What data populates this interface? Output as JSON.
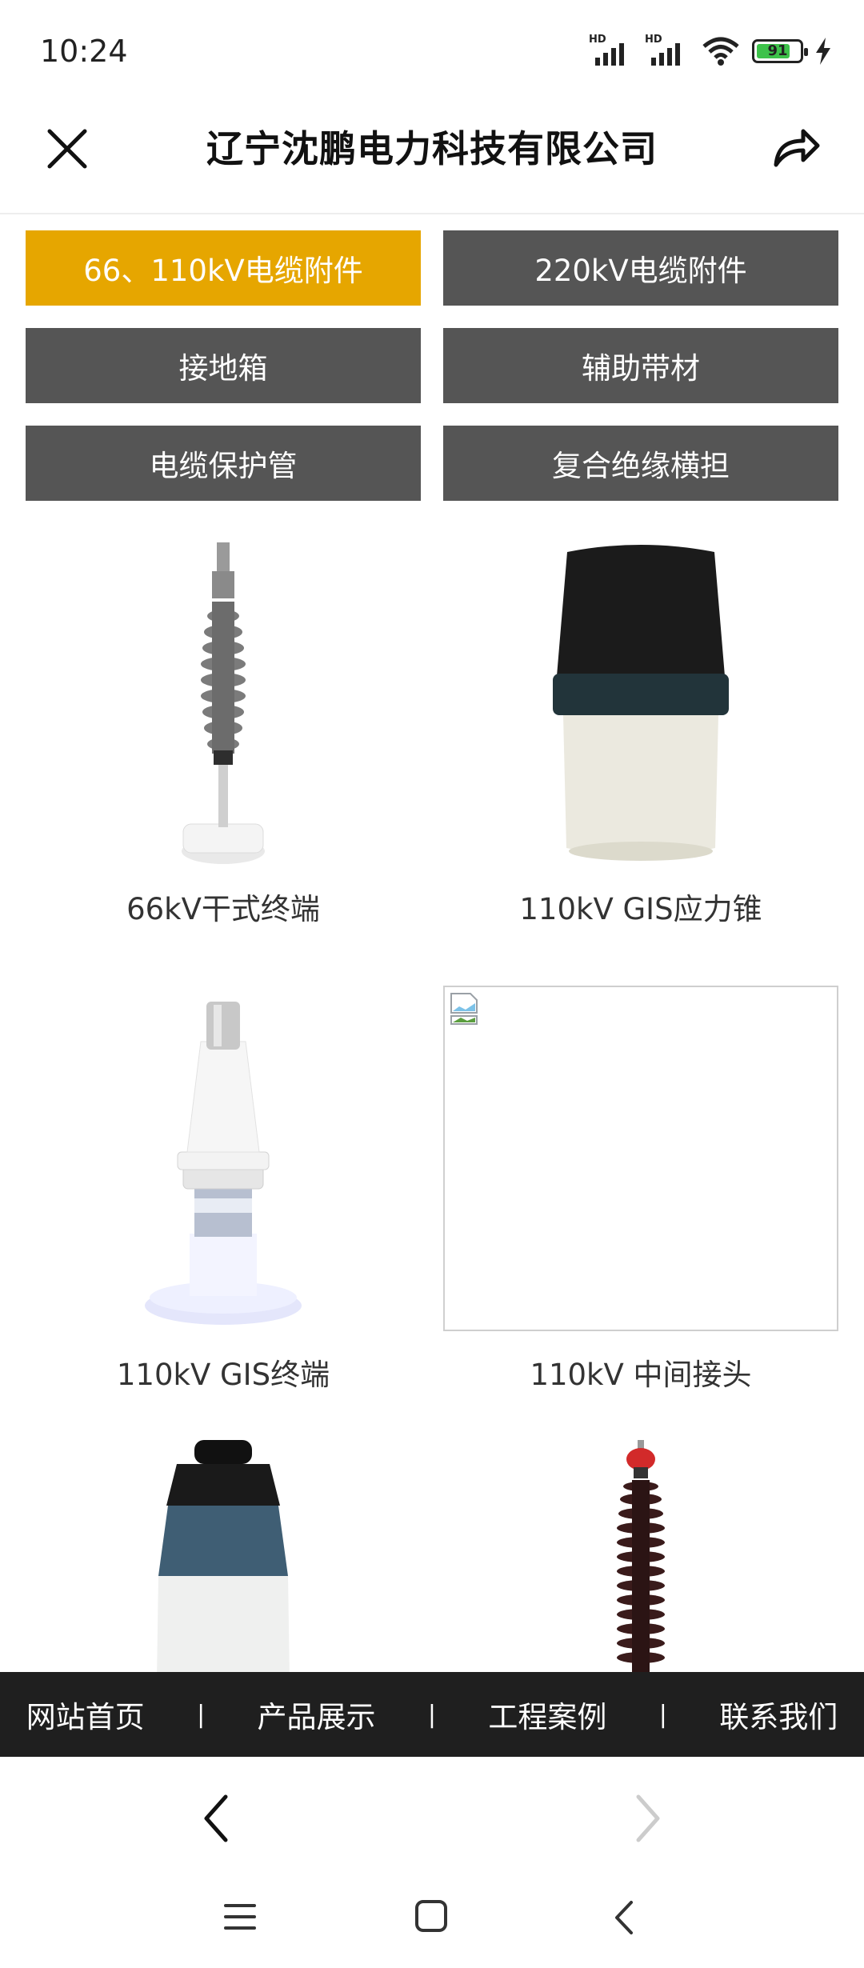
{
  "status_bar": {
    "time": "10:24",
    "battery": "91",
    "signal_label": "HD",
    "icons": [
      "signal-hd-icon",
      "signal-hd-icon",
      "wifi-icon",
      "battery-icon",
      "charging-bolt-icon"
    ]
  },
  "header": {
    "title": "辽宁沈鹏电力科技有限公司",
    "close_icon": "close-icon",
    "share_icon": "share-icon"
  },
  "categories": [
    {
      "label": "66、110kV电缆附件",
      "active": true
    },
    {
      "label": "220kV电缆附件",
      "active": false
    },
    {
      "label": "接地箱",
      "active": false
    },
    {
      "label": "辅助带材",
      "active": false
    },
    {
      "label": "电缆保护管",
      "active": false
    },
    {
      "label": "复合绝缘横担",
      "active": false
    }
  ],
  "colors": {
    "active_category": "#e6a600",
    "category": "#555555",
    "bottom_nav": "#1f1f1f"
  },
  "products": [
    {
      "label": "66kV干式终端"
    },
    {
      "label": "110kV GIS应力锥"
    },
    {
      "label": "110kV GIS终端"
    },
    {
      "label": "110kV 中间接头"
    }
  ],
  "bottom_nav": [
    {
      "label": "网站首页"
    },
    {
      "label": "产品展示"
    },
    {
      "label": "工程案例"
    },
    {
      "label": "联系我们"
    }
  ],
  "bottom_nav_separator": "|",
  "browser_nav": {
    "back_icon": "chevron-left-icon",
    "forward_icon": "chevron-right-icon"
  },
  "system_nav": {
    "icons": [
      "menu-icon",
      "home-square-icon",
      "back-icon"
    ]
  }
}
